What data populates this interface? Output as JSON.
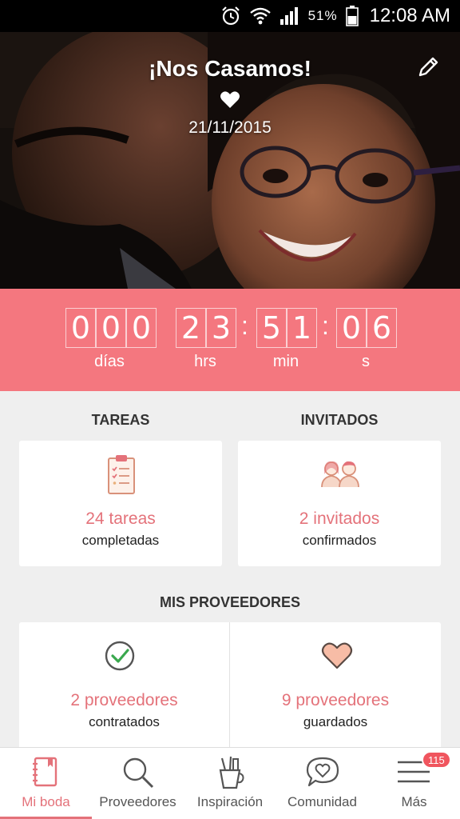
{
  "status_bar": {
    "battery_percent": "51%",
    "time": "12:08 AM",
    "icons": [
      "alarm-icon",
      "wifi-icon",
      "signal-icon",
      "battery-icon"
    ]
  },
  "hero": {
    "title": "¡Nos Casamos!",
    "date": "21/11/2015",
    "icons": [
      "heart-icon",
      "edit-pencil-icon"
    ]
  },
  "countdown": {
    "days": [
      "0",
      "0",
      "0"
    ],
    "hours": [
      "2",
      "3"
    ],
    "minutes": [
      "5",
      "1"
    ],
    "seconds": [
      "0",
      "6"
    ],
    "labels": {
      "days": "días",
      "hours": "hrs",
      "minutes": "min",
      "seconds": "s"
    }
  },
  "tasks": {
    "heading": "TAREAS",
    "count_label": "24 tareas",
    "sub_label": "completadas",
    "icon": "clipboard-checklist-icon"
  },
  "guests": {
    "heading": "INVITADOS",
    "count_label": "2 invitados",
    "sub_label": "confirmados",
    "icon": "guests-couple-icon"
  },
  "vendors": {
    "heading": "MIS PROVEEDORES",
    "hired": {
      "count_label": "2 proveedores",
      "sub_label": "contratados",
      "icon": "check-circle-icon"
    },
    "saved": {
      "count_label": "9 proveedores",
      "sub_label": "guardados",
      "icon": "heart-outline-icon"
    }
  },
  "bottom_nav": {
    "items": [
      {
        "label": "Mi boda",
        "icon": "notebook-icon",
        "active": true
      },
      {
        "label": "Proveedores",
        "icon": "search-icon",
        "active": false
      },
      {
        "label": "Inspiración",
        "icon": "pencil-cup-icon",
        "active": false
      },
      {
        "label": "Comunidad",
        "icon": "chat-heart-icon",
        "active": false
      },
      {
        "label": "Más",
        "icon": "menu-icon",
        "active": false
      }
    ],
    "more_badge": "115"
  },
  "colors": {
    "accent": "#f4777f",
    "accent_text": "#e4727a",
    "background": "#efefef",
    "badge": "#f0555e"
  }
}
